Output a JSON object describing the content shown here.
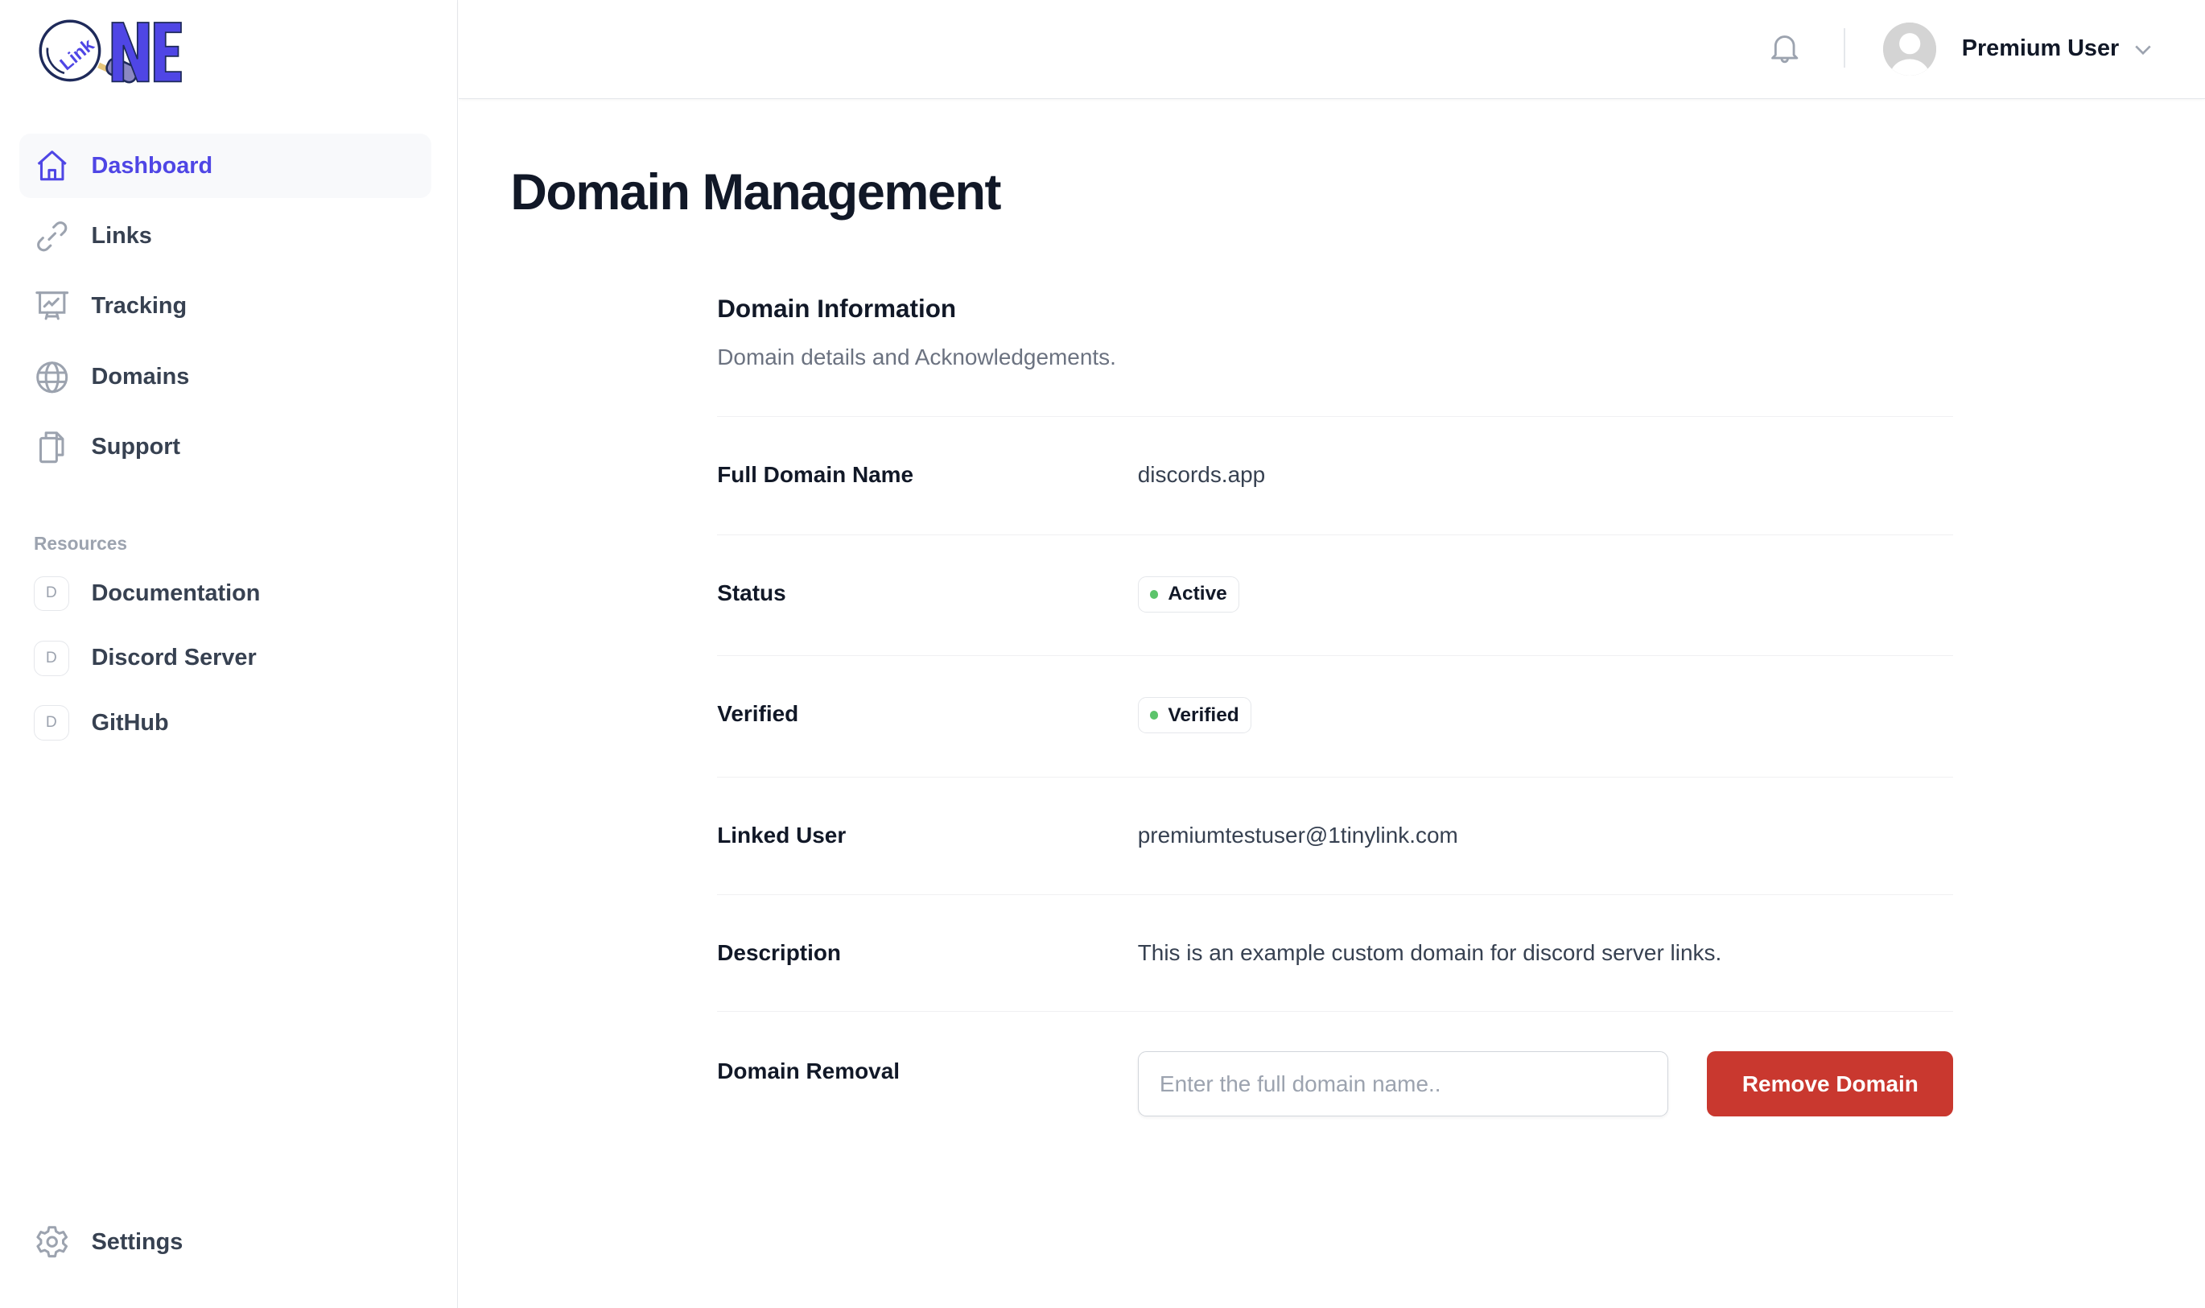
{
  "app": {
    "logo_text": "NE",
    "logo_badge_text": "Link"
  },
  "colors": {
    "brand": "#4f46e5",
    "status_green": "#5cc46b",
    "danger": "#c9382f"
  },
  "sidebar": {
    "items": [
      {
        "label": "Dashboard",
        "icon": "home-icon",
        "active": true
      },
      {
        "label": "Links",
        "icon": "link-icon",
        "active": false
      },
      {
        "label": "Tracking",
        "icon": "presentation-chart-icon",
        "active": false
      },
      {
        "label": "Domains",
        "icon": "globe-icon",
        "active": false
      },
      {
        "label": "Support",
        "icon": "documents-icon",
        "active": false
      }
    ],
    "resources_title": "Resources",
    "resources": [
      {
        "initial": "D",
        "label": "Documentation"
      },
      {
        "initial": "D",
        "label": "Discord Server"
      },
      {
        "initial": "D",
        "label": "GitHub"
      }
    ],
    "settings_label": "Settings"
  },
  "header": {
    "user_name": "Premium User",
    "notifications_icon": "bell-icon",
    "menu_icon": "chevron-down-icon"
  },
  "main": {
    "title": "Domain Management",
    "card": {
      "title": "Domain Information",
      "subtitle": "Domain details and Acknowledgements.",
      "fields": {
        "full_domain": {
          "label": "Full Domain Name",
          "value": "discords.app"
        },
        "status": {
          "label": "Status",
          "value": "Active"
        },
        "verified": {
          "label": "Verified",
          "value": "Verified"
        },
        "linked_user": {
          "label": "Linked User",
          "value": "premiumtestuser@1tinylink.com"
        },
        "description": {
          "label": "Description",
          "value": "This is an example custom domain for discord server links."
        },
        "removal": {
          "label": "Domain Removal",
          "input_value": "",
          "input_placeholder": "Enter the full domain name..",
          "button_label": "Remove Domain"
        }
      }
    }
  }
}
